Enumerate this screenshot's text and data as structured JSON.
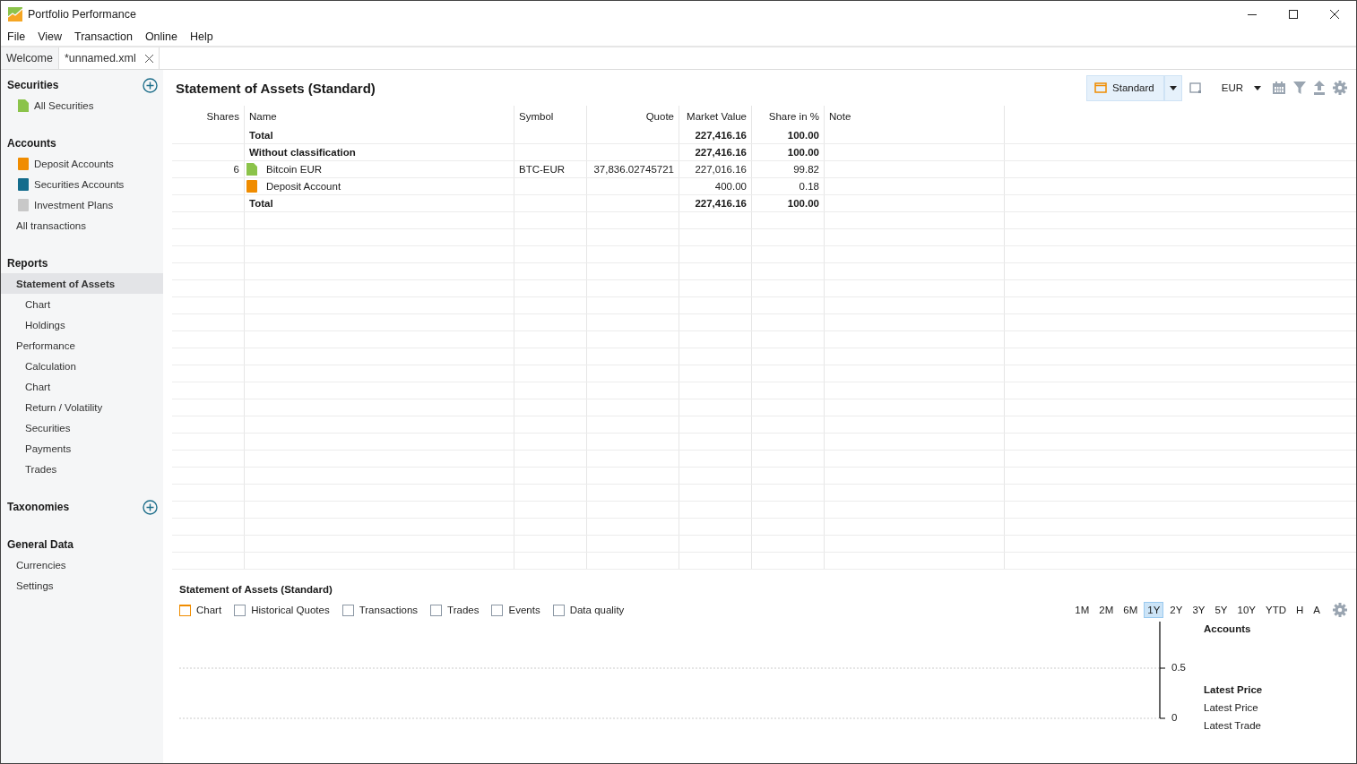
{
  "window": {
    "title": "Portfolio Performance"
  },
  "menu": [
    "File",
    "View",
    "Transaction",
    "Online",
    "Help"
  ],
  "tabs": [
    {
      "label": "Welcome",
      "selected": false,
      "closable": false
    },
    {
      "label": "*unnamed.xml",
      "selected": true,
      "closable": true
    }
  ],
  "sidebar": {
    "sections": [
      {
        "title": "Securities",
        "add_button": true,
        "items": [
          {
            "label": "All Securities",
            "kind": "security",
            "selected": false
          }
        ]
      },
      {
        "title": "Accounts",
        "add_button": false,
        "items": [
          {
            "label": "Deposit Accounts",
            "kind": "deposit",
            "selected": false
          },
          {
            "label": "Securities Accounts",
            "kind": "portfolio",
            "selected": false
          },
          {
            "label": "Investment Plans",
            "kind": "plan",
            "selected": false
          },
          {
            "label": "All transactions",
            "kind": "plain",
            "selected": false
          }
        ]
      },
      {
        "title": "Reports",
        "add_button": false,
        "items": [
          {
            "label": "Statement of Assets",
            "kind": "plain",
            "selected": true,
            "children": [
              {
                "label": "Chart",
                "selected": false
              },
              {
                "label": "Holdings",
                "selected": false
              }
            ]
          },
          {
            "label": "Performance",
            "kind": "plain",
            "selected": false,
            "children": [
              {
                "label": "Calculation",
                "selected": false
              },
              {
                "label": "Chart",
                "selected": false
              },
              {
                "label": "Return / Volatility",
                "selected": false
              },
              {
                "label": "Securities",
                "selected": false
              },
              {
                "label": "Payments",
                "selected": false
              },
              {
                "label": "Trades",
                "selected": false
              }
            ]
          }
        ]
      },
      {
        "title": "Taxonomies",
        "add_button": true
      },
      {
        "title": "General Data",
        "add_button": false,
        "items": [
          {
            "label": "Currencies",
            "kind": "plain",
            "selected": false
          },
          {
            "label": "Settings",
            "kind": "plain",
            "selected": false
          }
        ]
      }
    ]
  },
  "view": {
    "title": "Statement of Assets (Standard)",
    "view_selector": "Standard",
    "currency": "EUR"
  },
  "table": {
    "columns": [
      "Shares",
      "Name",
      "Symbol",
      "Quote",
      "Market Value",
      "Share in %",
      "Note"
    ],
    "rows": [
      {
        "kind": "group",
        "cells": [
          "",
          "Total",
          "",
          "",
          "227,416.16",
          "100.00",
          ""
        ]
      },
      {
        "kind": "group",
        "cells": [
          "",
          "Without classification",
          "",
          "",
          "227,416.16",
          "100.00",
          ""
        ]
      },
      {
        "kind": "security",
        "cells": [
          "6",
          "Bitcoin EUR",
          "BTC-EUR",
          "37,836.02745721",
          "227,016.16",
          "99.82",
          ""
        ]
      },
      {
        "kind": "deposit",
        "cells": [
          "",
          "Deposit Account",
          "",
          "",
          "400.00",
          "0.18",
          ""
        ]
      },
      {
        "kind": "group",
        "cells": [
          "",
          "Total",
          "",
          "",
          "227,416.16",
          "100.00",
          ""
        ]
      }
    ]
  },
  "details": {
    "title": "Statement of Assets (Standard)",
    "toggles": [
      {
        "label": "Chart",
        "checked": true
      },
      {
        "label": "Historical Quotes",
        "checked": false
      },
      {
        "label": "Transactions",
        "checked": false
      },
      {
        "label": "Trades",
        "checked": false
      },
      {
        "label": "Events",
        "checked": false
      },
      {
        "label": "Data quality",
        "checked": false
      }
    ],
    "periods": [
      {
        "label": "1M",
        "selected": false
      },
      {
        "label": "2M",
        "selected": false
      },
      {
        "label": "6M",
        "selected": false
      },
      {
        "label": "1Y",
        "selected": true
      },
      {
        "label": "2Y",
        "selected": false
      },
      {
        "label": "3Y",
        "selected": false
      },
      {
        "label": "5Y",
        "selected": false
      },
      {
        "label": "10Y",
        "selected": false
      },
      {
        "label": "YTD",
        "selected": false
      },
      {
        "label": "H",
        "selected": false
      },
      {
        "label": "A",
        "selected": false
      }
    ],
    "y_tick_labels": [
      "0.5",
      "0"
    ],
    "legend": [
      {
        "label": "Accounts",
        "bold": true
      },
      {
        "label": "Latest Price",
        "bold": true
      },
      {
        "label": "Latest Price",
        "bold": false
      },
      {
        "label": "Latest Trade",
        "bold": false
      }
    ]
  }
}
